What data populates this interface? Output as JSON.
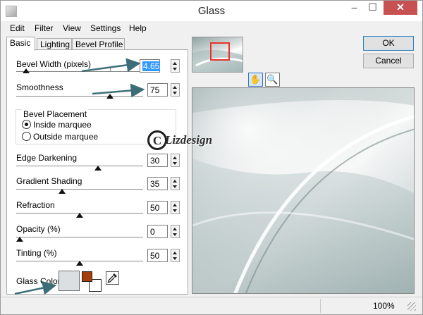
{
  "window": {
    "title": "Glass"
  },
  "title_buttons": {
    "minimize": "–",
    "maximize": "☐",
    "close": "✕"
  },
  "menu": [
    "Edit",
    "Filter",
    "View",
    "Settings",
    "Help"
  ],
  "tabs": [
    "Basic",
    "Lighting",
    "Bevel Profile"
  ],
  "basic": {
    "bevel_width": {
      "label": "Bevel Width (pixels)",
      "value": "4.65",
      "level": 0.05
    },
    "smoothness": {
      "label": "Smoothness",
      "value": "75",
      "level": 0.75
    },
    "bevel_placement": {
      "title": "Bevel Placement",
      "options": [
        "Inside marquee",
        "Outside marquee"
      ],
      "selected": "Inside marquee"
    },
    "edge_darkening": {
      "label": "Edge Darkening",
      "value": "30",
      "level": 0.65
    },
    "gradient_shading": {
      "label": "Gradient Shading",
      "value": "35",
      "level": 0.35
    },
    "refraction": {
      "label": "Refraction",
      "value": "50",
      "level": 0.5
    },
    "opacity": {
      "label": "Opacity (%)",
      "value": "0",
      "level": 0.0
    },
    "tinting": {
      "label": "Tinting (%)",
      "value": "50",
      "level": 0.5
    },
    "glass_color": {
      "label": "Glass Color",
      "swatch": "#dcdfe1",
      "foreground": "#a53f0c",
      "background": "#ffffff"
    }
  },
  "watermark": {
    "symbol": "C",
    "text": "Lizdesign"
  },
  "tools": {
    "hand": "✋",
    "zoom": "🔍"
  },
  "buttons": {
    "ok": "OK",
    "cancel": "Cancel"
  },
  "status": {
    "zoom": "100%"
  },
  "colors": {
    "accent": "#3399ff",
    "arrows": "#3d6e78",
    "close": "#c75050",
    "marquee": "#e8332a"
  }
}
